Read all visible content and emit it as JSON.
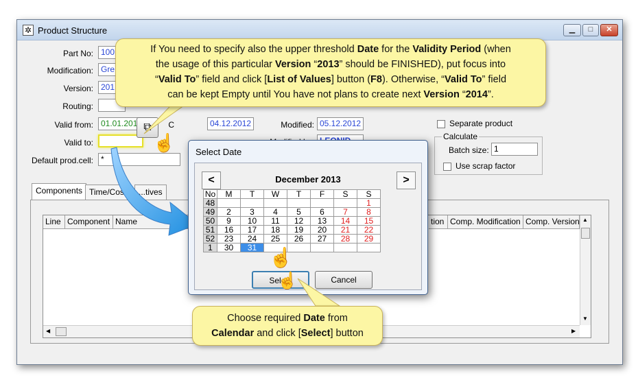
{
  "window": {
    "title": "Product Structure",
    "minimize_glyph": "▁",
    "maximize_glyph": "□",
    "close_glyph": "✕"
  },
  "form": {
    "part_no_label": "Part No:",
    "part_no_value": "100",
    "modification_label": "Modification:",
    "modification_value": "Gre",
    "version_label": "Version:",
    "version_value": "201",
    "routing_label": "Routing:",
    "routing_value": "",
    "valid_from_label": "Valid from:",
    "valid_from_value": "01.01.201",
    "created_label": "C",
    "created_value": "04.12.2012",
    "modified_label": "Modified:",
    "modified_value": "05.12.2012",
    "modified_by_label": "Modified by:",
    "modified_by_value": "LEONID",
    "valid_to_label": "Valid to:",
    "valid_to_value": "",
    "default_prod_cell_label": "Default prod.cell:",
    "default_prod_cell_value": "*",
    "separate_product_label": "Separate product",
    "calculate_group_label": "Calculate",
    "batch_size_label": "Batch size:",
    "batch_size_value": "1",
    "use_scrap_factor_label": "Use scrap factor"
  },
  "tabs": [
    "Components",
    "Time/Cost",
    "...tives"
  ],
  "grid": {
    "headers_left": [
      "Line",
      "Component",
      "Name"
    ],
    "headers_right": [
      "tion",
      "Comp. Modification",
      "Comp. Version"
    ]
  },
  "dialog": {
    "title": "Select Date",
    "prev": "<",
    "next": ">",
    "month_label": "December 2013",
    "week_header": "No",
    "day_headers": [
      "M",
      "T",
      "W",
      "T",
      "F",
      "S",
      "S"
    ],
    "rows": [
      {
        "week": "48",
        "days": [
          "",
          "",
          "",
          "",
          "",
          "",
          "1"
        ]
      },
      {
        "week": "49",
        "days": [
          "2",
          "3",
          "4",
          "5",
          "6",
          "7",
          "8"
        ]
      },
      {
        "week": "50",
        "days": [
          "9",
          "10",
          "11",
          "12",
          "13",
          "14",
          "15"
        ]
      },
      {
        "week": "51",
        "days": [
          "16",
          "17",
          "18",
          "19",
          "20",
          "21",
          "22"
        ]
      },
      {
        "week": "52",
        "days": [
          "23",
          "24",
          "25",
          "26",
          "27",
          "28",
          "29"
        ]
      },
      {
        "week": "1",
        "days": [
          "30",
          "31",
          "",
          "",
          "",
          "",
          ""
        ]
      }
    ],
    "selected_day": "31",
    "select_button": "Select",
    "cancel_button": "Cancel"
  },
  "callouts": {
    "top": [
      [
        {
          "t": "If You need to specify also the upper threshold "
        },
        {
          "t": "Date",
          "b": true
        },
        {
          "t": " for the "
        },
        {
          "t": "Validity Period",
          "b": true
        },
        {
          "t": " (when"
        }
      ],
      [
        {
          "t": "the usage of this particular "
        },
        {
          "t": "Version",
          "b": true
        },
        {
          "t": " “"
        },
        {
          "t": "2013",
          "b": true
        },
        {
          "t": "” should be FINISHED), put focus into"
        }
      ],
      [
        {
          "t": "“"
        },
        {
          "t": "Valid To",
          "b": true
        },
        {
          "t": "” field and click ["
        },
        {
          "t": "List of Values",
          "b": true
        },
        {
          "t": "] button ("
        },
        {
          "t": "F8",
          "b": true
        },
        {
          "t": ").  Otherwise, “"
        },
        {
          "t": "Valid To",
          "b": true
        },
        {
          "t": "” field"
        }
      ],
      [
        {
          "t": "can be kept Empty until You have not plans to create next "
        },
        {
          "t": "Version",
          "b": true
        },
        {
          "t": " “"
        },
        {
          "t": "2014",
          "b": true
        },
        {
          "t": "”."
        }
      ]
    ],
    "bottom": [
      [
        {
          "t": "Choose required "
        },
        {
          "t": "Date",
          "b": true
        },
        {
          "t": " from"
        }
      ],
      [
        {
          "t": "Calendar",
          "b": true
        },
        {
          "t": " and click ["
        },
        {
          "t": "Select",
          "b": true
        },
        {
          "t": "] button"
        }
      ]
    ]
  },
  "colors": {
    "callout_bg": "#fcf6a4",
    "arrow_blue": "#1f8fe0",
    "sunday_red": "#e02020",
    "selected_blue": "#3d8ee8",
    "field_text_blue": "#2a47d6"
  }
}
